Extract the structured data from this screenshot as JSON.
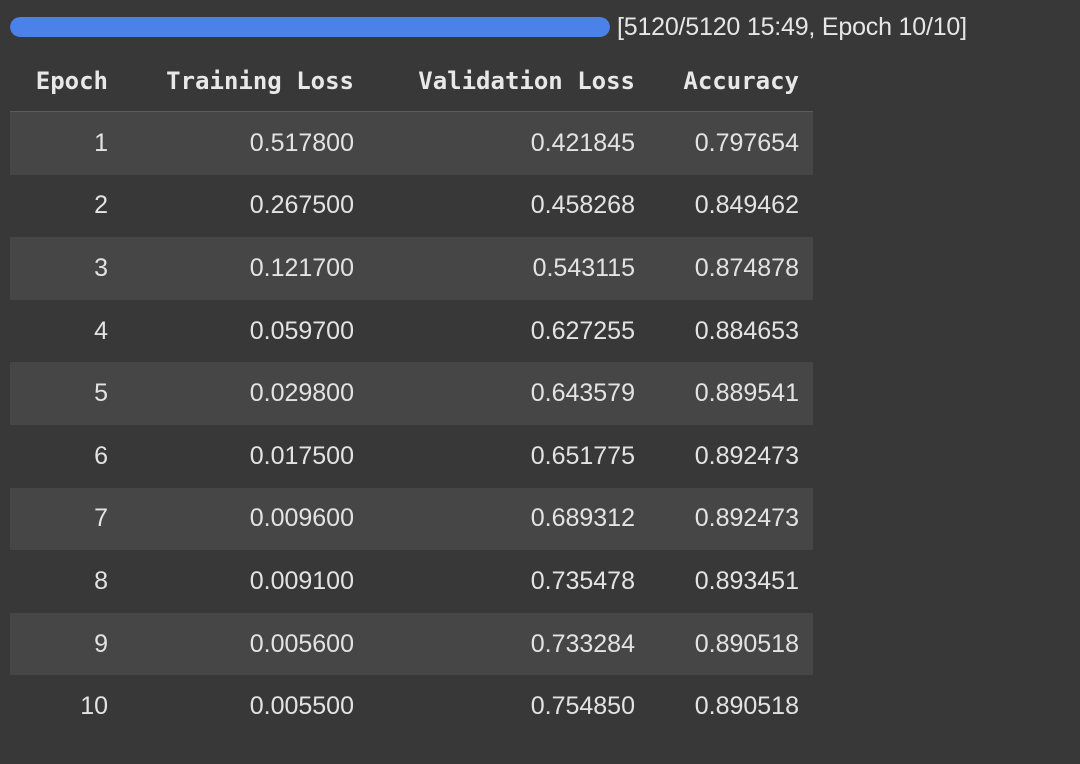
{
  "progress": {
    "current": 5120,
    "total": 5120,
    "fraction": 1.0,
    "status_text": "[5120/5120 15:49, Epoch 10/10]",
    "bar_color": "#4b82ea"
  },
  "table": {
    "columns": [
      "Epoch",
      "Training Loss",
      "Validation Loss",
      "Accuracy"
    ],
    "rows": [
      [
        "1",
        "0.517800",
        "0.421845",
        "0.797654"
      ],
      [
        "2",
        "0.267500",
        "0.458268",
        "0.849462"
      ],
      [
        "3",
        "0.121700",
        "0.543115",
        "0.874878"
      ],
      [
        "4",
        "0.059700",
        "0.627255",
        "0.884653"
      ],
      [
        "5",
        "0.029800",
        "0.643579",
        "0.889541"
      ],
      [
        "6",
        "0.017500",
        "0.651775",
        "0.892473"
      ],
      [
        "7",
        "0.009600",
        "0.689312",
        "0.892473"
      ],
      [
        "8",
        "0.009100",
        "0.735478",
        "0.893451"
      ],
      [
        "9",
        "0.005600",
        "0.733284",
        "0.890518"
      ],
      [
        "10",
        "0.005500",
        "0.754850",
        "0.890518"
      ]
    ]
  }
}
